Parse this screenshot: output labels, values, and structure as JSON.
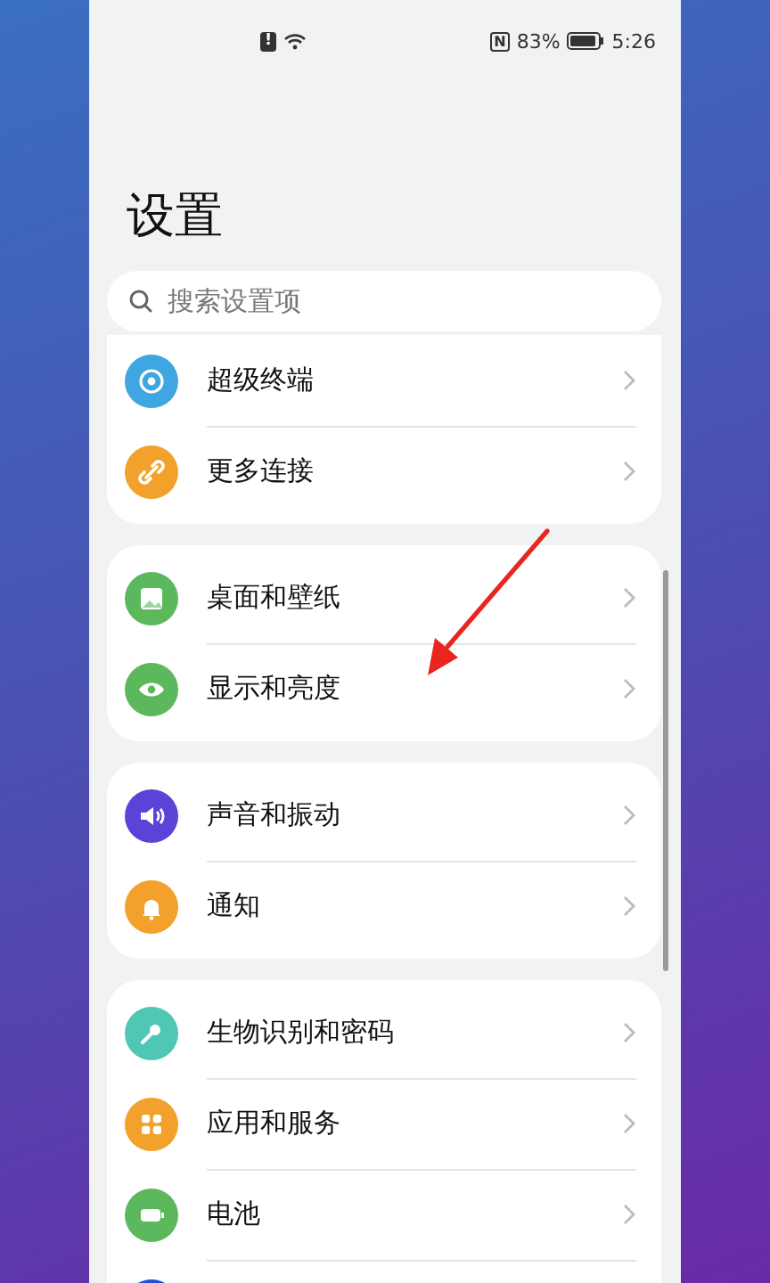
{
  "status_bar": {
    "alert": "!",
    "nfc": "N",
    "battery_percent": "83%",
    "time": "5:26"
  },
  "title": "设置",
  "search": {
    "placeholder": "搜索设置项"
  },
  "groups": [
    {
      "items": [
        {
          "label": "超级终端",
          "kind": "devices",
          "color": "#3ea6e0"
        },
        {
          "label": "更多连接",
          "kind": "link",
          "color": "#f2a22c"
        }
      ]
    },
    {
      "items": [
        {
          "label": "桌面和壁纸",
          "kind": "wallpaper",
          "color": "#5cb85c"
        },
        {
          "label": "显示和亮度",
          "kind": "eye",
          "color": "#5cb85c"
        }
      ]
    },
    {
      "items": [
        {
          "label": "声音和振动",
          "kind": "sound",
          "color": "#5a44d8"
        },
        {
          "label": "通知",
          "kind": "bell",
          "color": "#f2a22c"
        }
      ]
    },
    {
      "items": [
        {
          "label": "生物识别和密码",
          "kind": "key",
          "color": "#4fc7b5"
        },
        {
          "label": "应用和服务",
          "kind": "apps",
          "color": "#f2a22c"
        },
        {
          "label": "电池",
          "kind": "battery",
          "color": "#5cb85c"
        },
        {
          "kind": "blank",
          "color": "#1f4fd0"
        }
      ]
    }
  ]
}
